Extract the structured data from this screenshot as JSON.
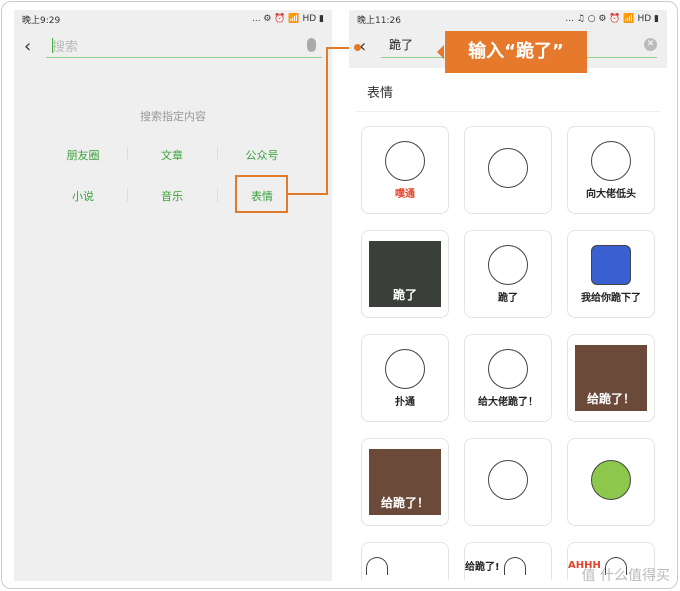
{
  "left_phone": {
    "status_time": "晚上9:29",
    "status_icons": "... ⚙ ⏰ 📶 HD ▮",
    "search_placeholder": "搜索",
    "hint": "搜索指定内容",
    "categories": [
      "朋友圈",
      "文章",
      "公众号",
      "小说",
      "音乐",
      "表情"
    ]
  },
  "right_phone": {
    "status_time": "晚上11:26",
    "status_icons": "... ♫ ○ ⚙ ⏰ 📶 HD ▮",
    "query": "跪了",
    "section": "表情",
    "stickers": [
      {
        "caption": "噗通"
      },
      {
        "caption": ""
      },
      {
        "caption": "向大佬低头"
      },
      {
        "caption": "跪了"
      },
      {
        "caption": "跪了"
      },
      {
        "caption": "我给你跪下了"
      },
      {
        "caption": "扑通"
      },
      {
        "caption": "给大佬跪了！"
      },
      {
        "caption": "给跪了！"
      },
      {
        "caption": "给跪了！"
      },
      {
        "caption": ""
      },
      {
        "caption": ""
      },
      {
        "caption": ""
      },
      {
        "caption": "给跪了!"
      },
      {
        "caption": "AHHH"
      }
    ]
  },
  "callout": "输入“跪了”",
  "watermark": "值 什么值得买",
  "colors": {
    "accent": "#e7792c",
    "green": "#3ba13b"
  }
}
